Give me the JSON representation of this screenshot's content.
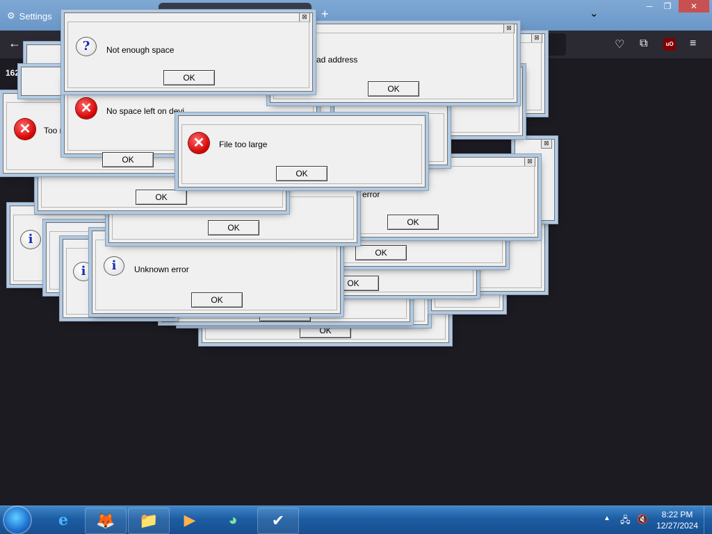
{
  "browser": {
    "tab_title": "Settings",
    "new_tab_symbol": "+",
    "tab_list_symbol": "⌄",
    "page_snippet": "162"
  },
  "window_controls": {
    "minimize": "─",
    "restore": "❐",
    "close": "✕"
  },
  "dialogs": [
    {
      "id": "d1",
      "message": "Not enough space",
      "icon": "question-icon",
      "button": "OK"
    },
    {
      "id": "d2",
      "message": "Bad address",
      "icon": "none",
      "button": "OK"
    },
    {
      "id": "d3",
      "message": "No space left on devi",
      "icon": "error-icon",
      "button": "OK"
    },
    {
      "id": "d4",
      "message": "File too large",
      "icon": "error-icon",
      "button": "OK"
    },
    {
      "id": "d5",
      "message": "Too m",
      "icon": "error-icon",
      "button": "OK"
    },
    {
      "id": "d6",
      "message": "n error",
      "icon": "none",
      "button": "OK"
    },
    {
      "id": "d7",
      "message": "Unknown error",
      "icon": "info-icon",
      "button": "OK"
    },
    {
      "id": "d8",
      "message": "Un",
      "icon": "info-icon",
      "button": "OK"
    }
  ],
  "generic_button": "OK",
  "taskbar": {
    "apps": [
      {
        "name": "internet-explorer-icon",
        "glyph": "e",
        "pinned": false
      },
      {
        "name": "firefox-icon",
        "glyph": "🦊",
        "pinned": true
      },
      {
        "name": "file-explorer-icon",
        "glyph": "📁",
        "pinned": true
      },
      {
        "name": "media-player-icon",
        "glyph": "▶",
        "pinned": true
      },
      {
        "name": "messenger-icon",
        "glyph": "◕",
        "pinned": true
      },
      {
        "name": "task-app-icon",
        "glyph": "✔",
        "pinned": true
      }
    ],
    "clock_time": "8:22 PM",
    "clock_date": "12/27/2024"
  },
  "colors": {
    "titlebar": "#7fa8d4",
    "toolbar": "#2b2a33",
    "page_bg": "#1c1b22",
    "taskbar": "#1d5da3",
    "error_red": "#d40000",
    "info_blue": "#1a2bb5"
  }
}
